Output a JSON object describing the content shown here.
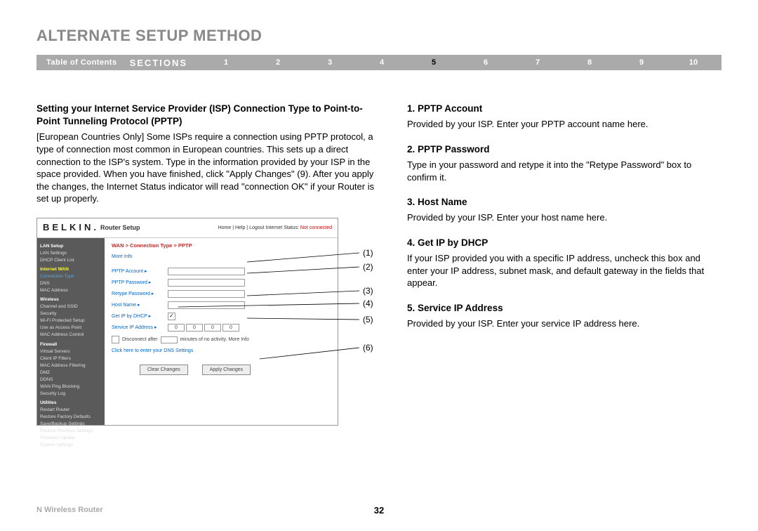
{
  "title": "ALTERNATE SETUP METHOD",
  "nav": {
    "toc": "Table of Contents",
    "sections": "SECTIONS",
    "nums": [
      "1",
      "2",
      "3",
      "4",
      "5",
      "6",
      "7",
      "8",
      "9",
      "10"
    ],
    "active": "5"
  },
  "left": {
    "heading": "Setting your Internet Service Provider (ISP) Connection Type to Point-to-Point Tunneling Protocol (PPTP)",
    "body": "[European Countries Only] Some ISPs require a connection using PPTP protocol, a type of connection most common in European countries. This sets up a direct connection to the ISP's system. Type in the information provided by your ISP in the space provided. When you have finished, click \"Apply Changes\" (9). After you apply the changes, the Internet Status indicator will read \"connection OK\" if your Router is set up properly."
  },
  "router": {
    "brand": "BELKIN",
    "setup": "Router Setup",
    "toplinks": "Home | Help | Logout   Internet Status:",
    "notconn": "Not connected",
    "breadcrumb": "WAN > Connection Type > PPTP",
    "moreinfo": "More Info",
    "fields": {
      "acct": "PPTP Account ▸",
      "pwd": "PPTP Password ▸",
      "retype": "Retype Password ▸",
      "host": "Host Name ▸",
      "dhcp": "Get IP by DHCP ▸",
      "svcip": "Service IP Address ▸"
    },
    "ip": [
      "0",
      "0",
      "0",
      "0"
    ],
    "disconnect_pre": "Disconnect after",
    "disconnect_post": "minutes of no activity. More Info",
    "dns": "Click here to enter your DNS Settings",
    "clear": "Clear Changes",
    "apply": "Apply Changes",
    "side": {
      "g1": "LAN Setup",
      "g1a": "LAN Settings",
      "g1b": "DHCP Client List",
      "g2": "Internet WAN",
      "g2a": "Connection Type",
      "g2b": "DNS",
      "g2c": "MAC Address",
      "g3": "Wireless",
      "g3a": "Channel and SSID",
      "g3b": "Security",
      "g3c": "Wi-Fi Protected Setup",
      "g3d": "Use as Access Point",
      "g3e": "MAC Address Control",
      "g4": "Firewall",
      "g4a": "Virtual Servers",
      "g4b": "Client IP Filters",
      "g4c": "MAC Address Filtering",
      "g4d": "DMZ",
      "g4e": "DDNS",
      "g4f": "WAN Ping Blocking",
      "g4g": "Security Log",
      "g5": "Utilities",
      "g5a": "Restart Router",
      "g5b": "Restore Factory Defaults",
      "g5c": "Save/Backup Settings",
      "g5d": "Restore Previous Settings",
      "g5e": "Firmware Update",
      "g5f": "System Settings"
    }
  },
  "callout_nums": [
    "(1)",
    "(2)",
    "(3)",
    "(4)",
    "(5)",
    "(6)"
  ],
  "right": [
    {
      "h": "1.   PPTP Account",
      "b": "Provided by your ISP. Enter your PPTP account name here."
    },
    {
      "h": "2.   PPTP Password",
      "b": "Type in your password and retype it into the \"Retype Password\" box to confirm it."
    },
    {
      "h": "3.   Host Name",
      "b": "Provided by your ISP. Enter your host name here."
    },
    {
      "h": "4.   Get IP by DHCP",
      "b": "If your ISP provided you with a specific IP address, uncheck this box and enter your IP address, subnet mask, and default gateway in the fields that appear."
    },
    {
      "h": "5.   Service IP Address",
      "b": "Provided by your ISP. Enter your service IP address here."
    }
  ],
  "footer": {
    "left": "N Wireless Router",
    "page": "32"
  }
}
